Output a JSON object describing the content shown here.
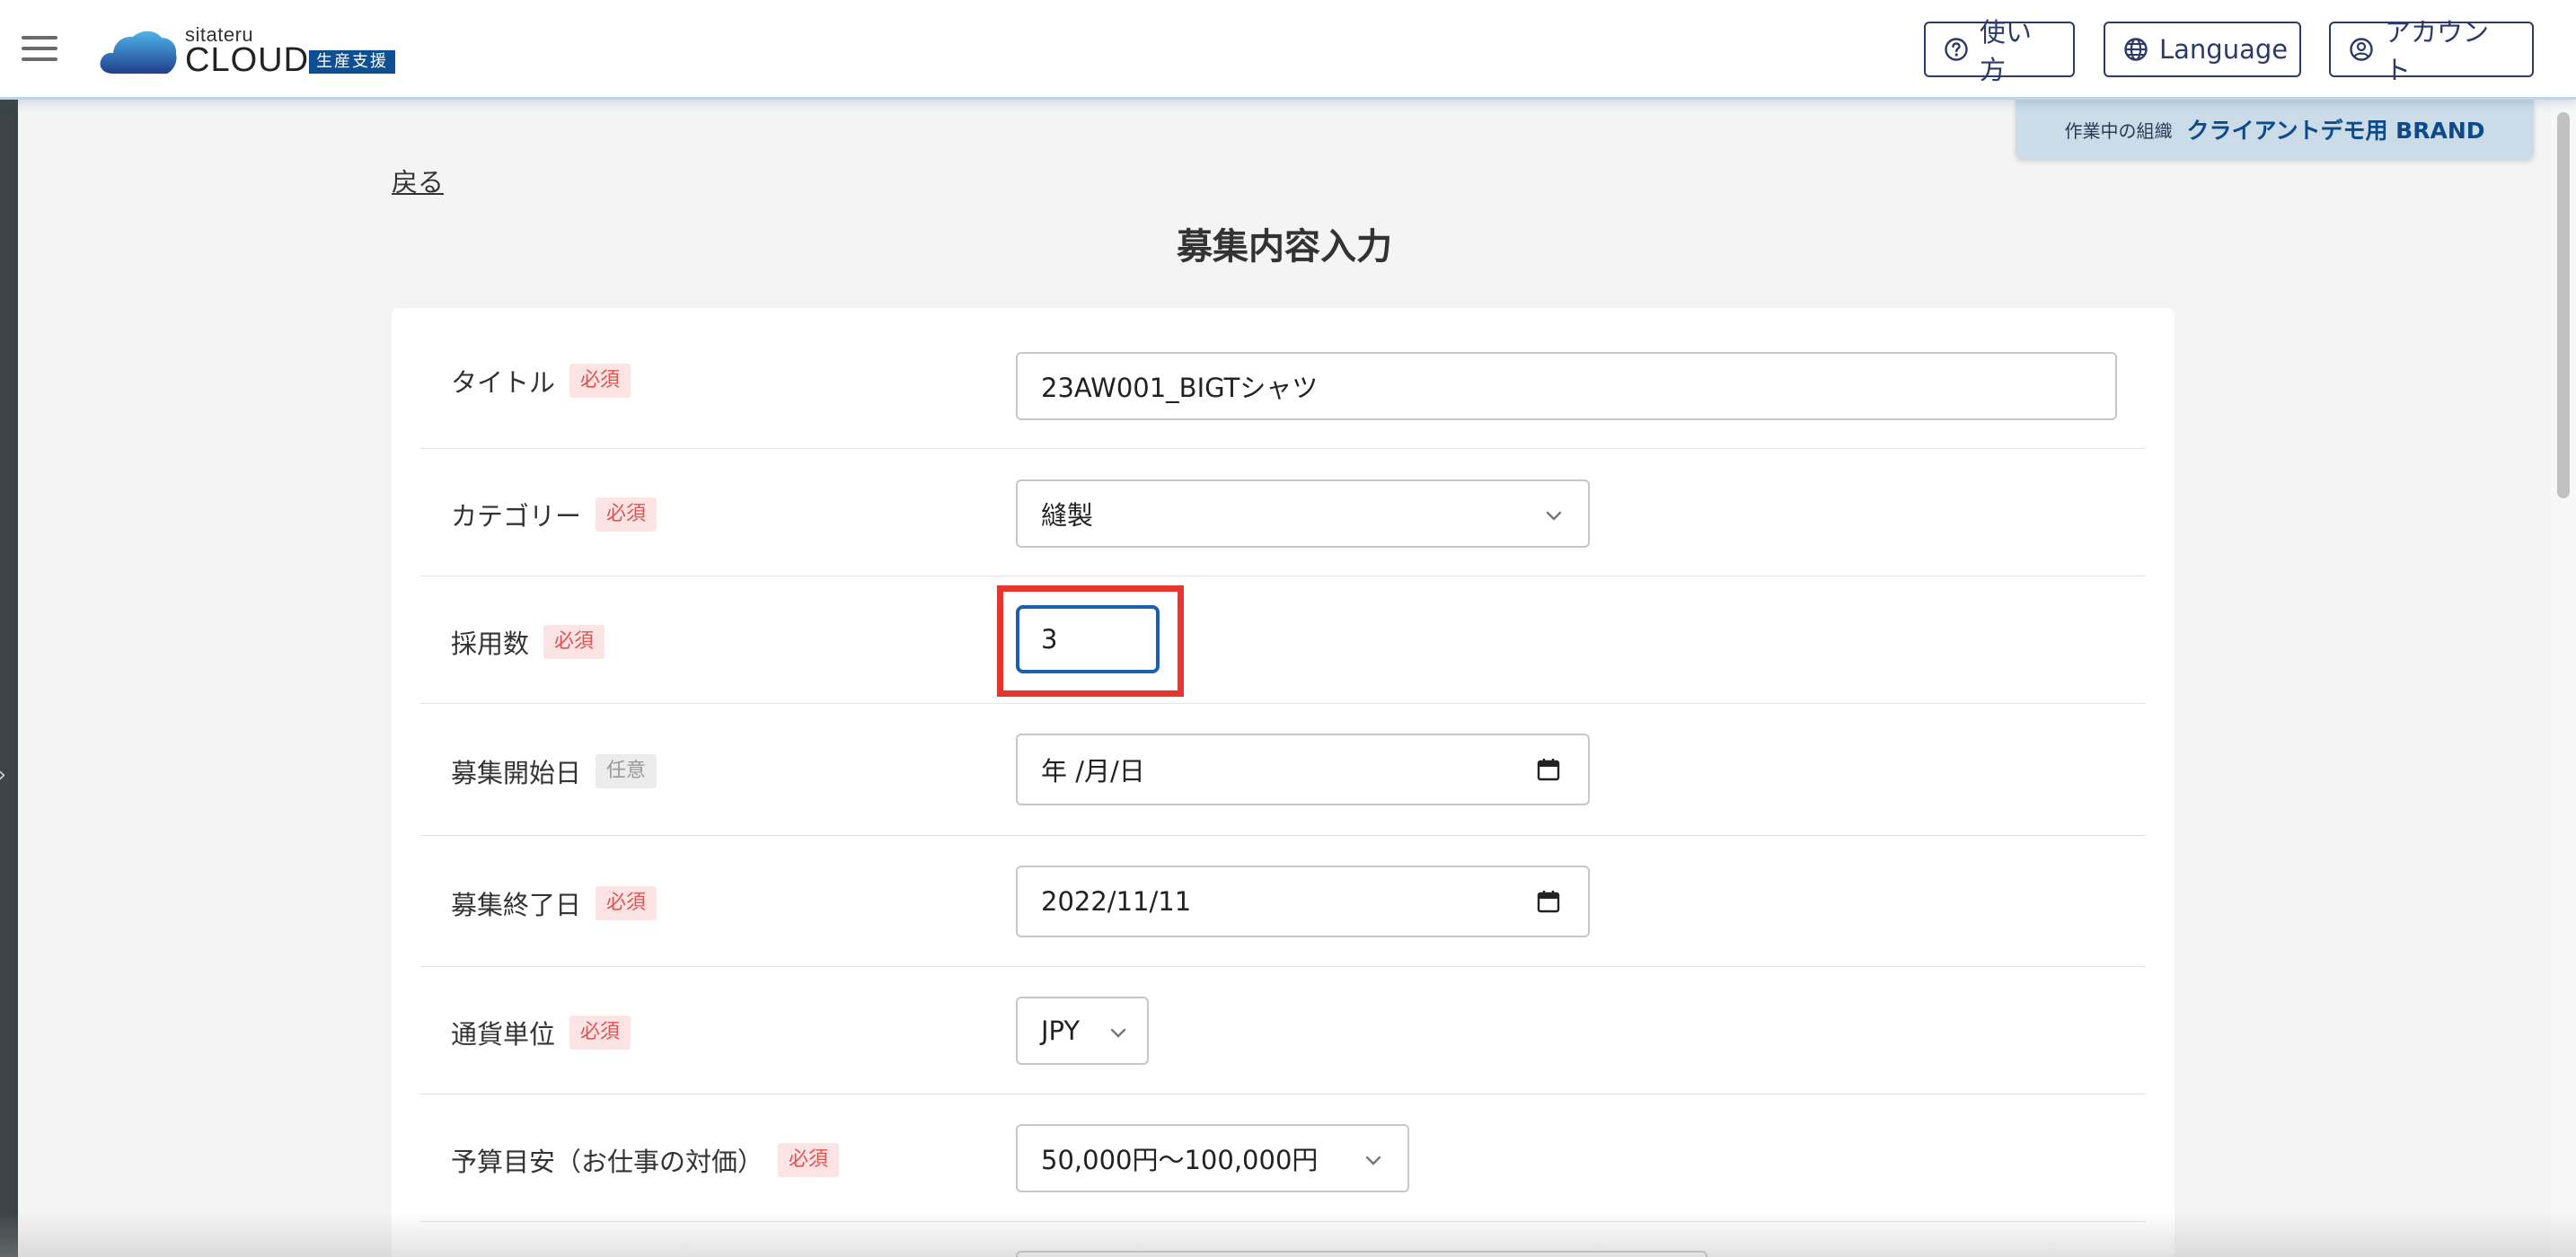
{
  "header": {
    "logo_small": "sitateru",
    "logo_big": "CLOUD",
    "logo_badge": "生産支援",
    "help_label": "使い方",
    "language_label": "Language",
    "account_label": "アカウント"
  },
  "org": {
    "label": "作業中の組織",
    "name": "クライアントデモ用 BRAND"
  },
  "nav": {
    "back_label": "戻る"
  },
  "page": {
    "title": "募集内容入力"
  },
  "tags": {
    "required": "必須",
    "optional": "任意"
  },
  "form": {
    "title_label": "タイトル",
    "title_value": "23AW001_BIGTシャツ",
    "category_label": "カテゴリー",
    "category_value": "縫製",
    "hires_label": "採用数",
    "hires_value": "3",
    "start_label": "募集開始日",
    "start_value": "年 /月/日",
    "end_label": "募集終了日",
    "end_value": "2022/11/11",
    "currency_label": "通貨単位",
    "currency_value": "JPY",
    "budget_label": "予算目安（お仕事の対価）",
    "budget_value": "50,000円〜100,000円"
  },
  "colors": {
    "brand": "#0c4f93",
    "required_tag_bg": "#fde4e4",
    "required_tag_text": "#e0524f",
    "highlight": "#e8352b",
    "focus": "#1b5fae"
  }
}
